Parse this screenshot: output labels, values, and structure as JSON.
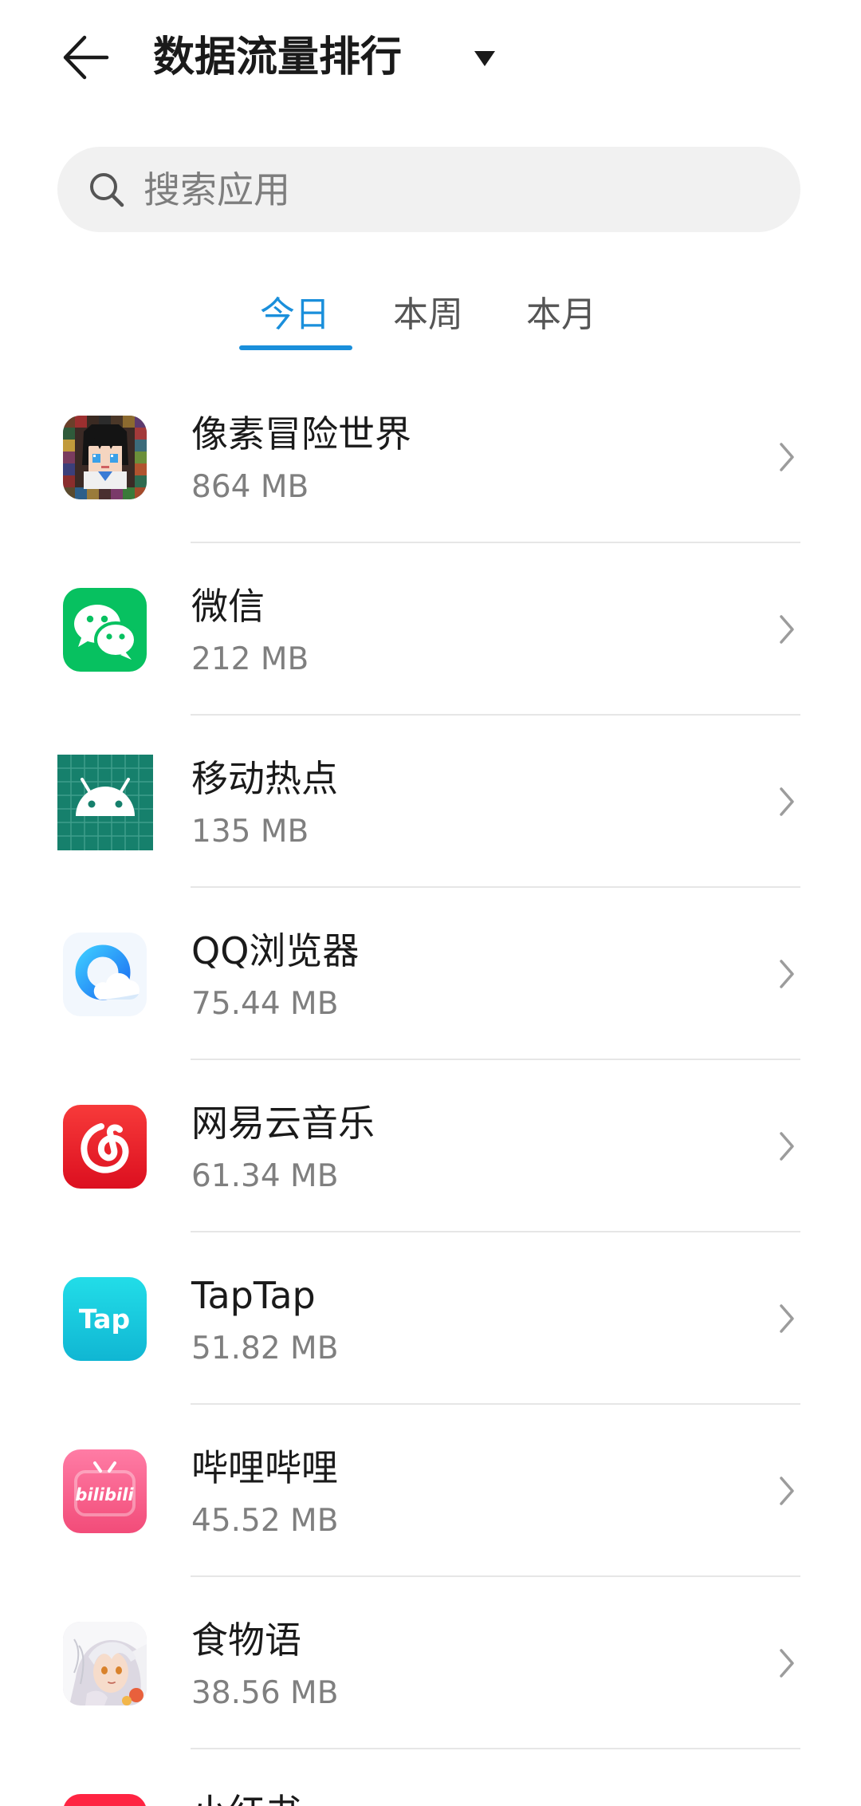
{
  "header": {
    "title": "数据流量排行",
    "back_icon": "back-arrow-icon",
    "dropdown_icon": "dropdown-triangle-icon"
  },
  "search": {
    "placeholder": "搜索应用",
    "value": "",
    "icon": "search-icon"
  },
  "tabs": [
    {
      "label": "今日",
      "selected": true
    },
    {
      "label": "本周",
      "selected": false
    },
    {
      "label": "本月",
      "selected": false
    }
  ],
  "apps": [
    {
      "name": "像素冒险世界",
      "usage": "864 MB",
      "icon": "pixel-adventure-world-icon"
    },
    {
      "name": "微信",
      "usage": "212 MB",
      "icon": "wechat-icon"
    },
    {
      "name": "移动热点",
      "usage": "135 MB",
      "icon": "android-hotspot-icon"
    },
    {
      "name": "QQ浏览器",
      "usage": "75.44 MB",
      "icon": "qq-browser-icon"
    },
    {
      "name": "网易云音乐",
      "usage": "61.34 MB",
      "icon": "netease-cloud-music-icon"
    },
    {
      "name": "TapTap",
      "usage": "51.82 MB",
      "icon": "taptap-icon",
      "logo_text": "Tap"
    },
    {
      "name": "哔哩哔哩",
      "usage": "45.52 MB",
      "icon": "bilibili-icon",
      "logo_text": "bilibili"
    },
    {
      "name": "食物语",
      "usage": "38.56 MB",
      "icon": "shiwuyu-icon"
    },
    {
      "name": "小红书",
      "icon": "xiaohongshu-icon"
    }
  ],
  "row_chevron_icon": "chevron-right-icon",
  "colors": {
    "accent": "#1A8FDB",
    "text_primary": "#1A1A1A",
    "text_secondary": "#7F7F7F",
    "search_background": "#F1F1F1",
    "divider": "#E6E6E6",
    "chevron": "#9C9C9C"
  }
}
